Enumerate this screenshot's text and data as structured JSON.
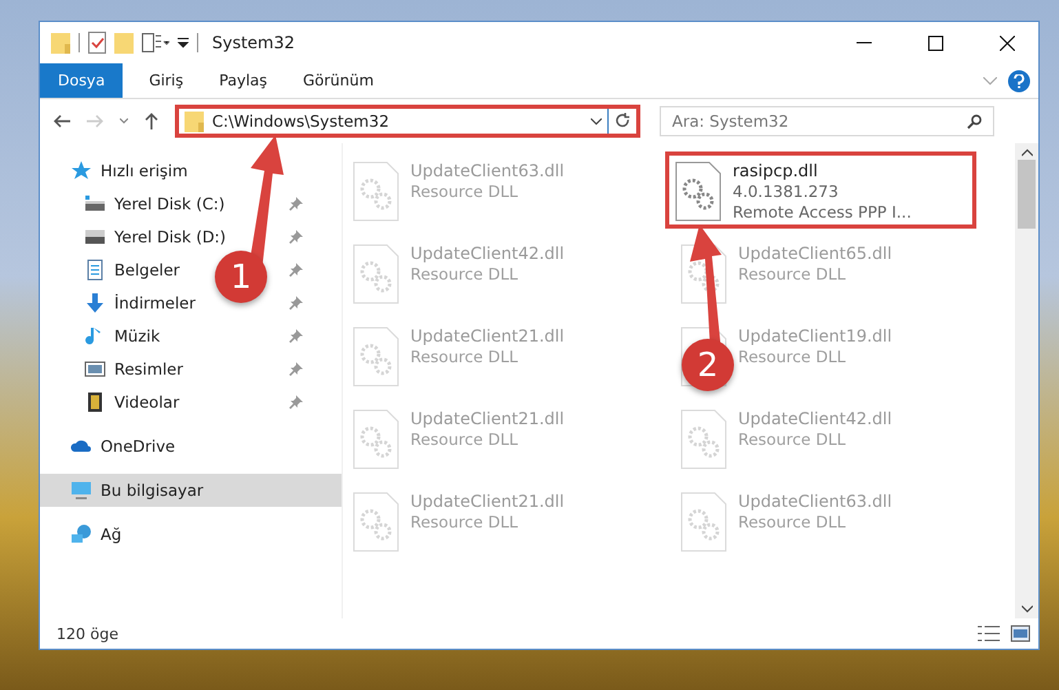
{
  "window": {
    "title": "System32"
  },
  "ribbon": {
    "tabs": [
      {
        "label": "Dosya",
        "selected": true
      },
      {
        "label": "Giriş",
        "selected": false
      },
      {
        "label": "Paylaş",
        "selected": false
      },
      {
        "label": "Görünüm",
        "selected": false
      }
    ]
  },
  "address_bar": {
    "path": "C:\\Windows\\System32",
    "highlighted": true
  },
  "search": {
    "placeholder": "Ara: System32"
  },
  "sidebar": {
    "items": [
      {
        "label": "Hızlı erişim",
        "kind": "star",
        "selected": false,
        "children": [
          {
            "label": "Yerel Disk (C:)",
            "kind": "drive-c",
            "pinned": true
          },
          {
            "label": "Yerel Disk (D:)",
            "kind": "drive",
            "pinned": true
          },
          {
            "label": "Belgeler",
            "kind": "document",
            "pinned": true
          },
          {
            "label": "İndirmeler",
            "kind": "download",
            "pinned": true
          },
          {
            "label": "Müzik",
            "kind": "music",
            "pinned": true
          },
          {
            "label": "Resimler",
            "kind": "picture",
            "pinned": true
          },
          {
            "label": "Videolar",
            "kind": "video",
            "pinned": true
          }
        ]
      },
      {
        "label": "OneDrive",
        "kind": "cloud",
        "selected": false
      },
      {
        "label": "Bu bilgisayar",
        "kind": "computer",
        "selected": true
      },
      {
        "label": "Ağ",
        "kind": "network",
        "selected": false
      }
    ]
  },
  "files": [
    {
      "name": "UpdateClient63.dll",
      "details": [
        "Resource DLL"
      ],
      "faded": true,
      "highlighted": false
    },
    {
      "name": "rasipcp.dll",
      "details": [
        "4.0.1381.273",
        "Remote Access PPP I..."
      ],
      "faded": false,
      "highlighted": true
    },
    {
      "name": "UpdateClient42.dll",
      "details": [
        "Resource DLL"
      ],
      "faded": true,
      "highlighted": false
    },
    {
      "name": "UpdateClient65.dll",
      "details": [
        "Resource DLL"
      ],
      "faded": true,
      "highlighted": false
    },
    {
      "name": "UpdateClient21.dll",
      "details": [
        "Resource DLL"
      ],
      "faded": true,
      "highlighted": false
    },
    {
      "name": "UpdateClient19.dll",
      "details": [
        "Resource DLL"
      ],
      "faded": true,
      "highlighted": false
    },
    {
      "name": "UpdateClient21.dll",
      "details": [
        "Resource DLL"
      ],
      "faded": true,
      "highlighted": false
    },
    {
      "name": "UpdateClient42.dll",
      "details": [
        "Resource DLL"
      ],
      "faded": true,
      "highlighted": false
    },
    {
      "name": "UpdateClient21.dll",
      "details": [
        "Resource DLL"
      ],
      "faded": true,
      "highlighted": false
    },
    {
      "name": "UpdateClient63.dll",
      "details": [
        "Resource DLL"
      ],
      "faded": true,
      "highlighted": false
    }
  ],
  "status_bar": {
    "count": "120 öge"
  },
  "annotations": [
    {
      "number": "1"
    },
    {
      "number": "2"
    }
  ]
}
